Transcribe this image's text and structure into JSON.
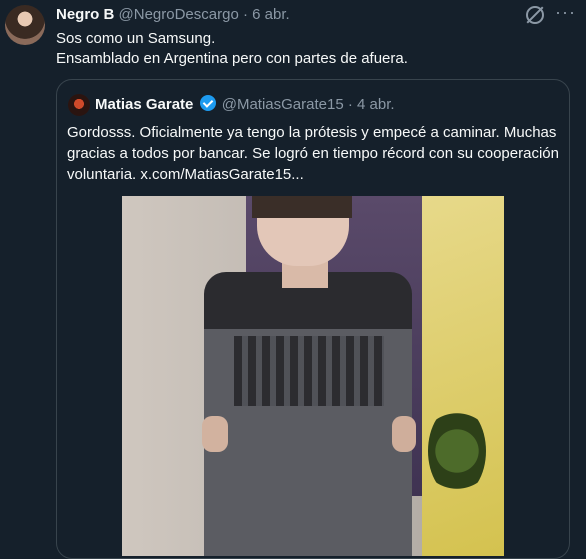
{
  "tweet": {
    "display_name": "Negro B",
    "handle": "@NegroDescargo",
    "separator": "·",
    "date": "6 abr.",
    "text": "Sos como un Samsung.\nEnsamblado en Argentina pero con partes de afuera.",
    "more_icon": "···"
  },
  "quote": {
    "display_name": "Matias Garate",
    "handle": "@MatiasGarate15",
    "separator": "·",
    "date": "4 abr.",
    "text": "Gordosss. Oficialmente ya tengo la prótesis y empecé a caminar. Muchas gracias a todos por bancar. Se logró en tiempo récord con su cooperación voluntaria.  x.com/MatiasGarate15..."
  },
  "icons": [
    "avatar",
    "grok-icon",
    "more-icon",
    "verified-badge-icon"
  ],
  "colors": {
    "background": "#15202b",
    "text": "#f7f9f9",
    "muted": "#8b98a5",
    "border": "#38444d",
    "verified": "#1d9bf0"
  }
}
